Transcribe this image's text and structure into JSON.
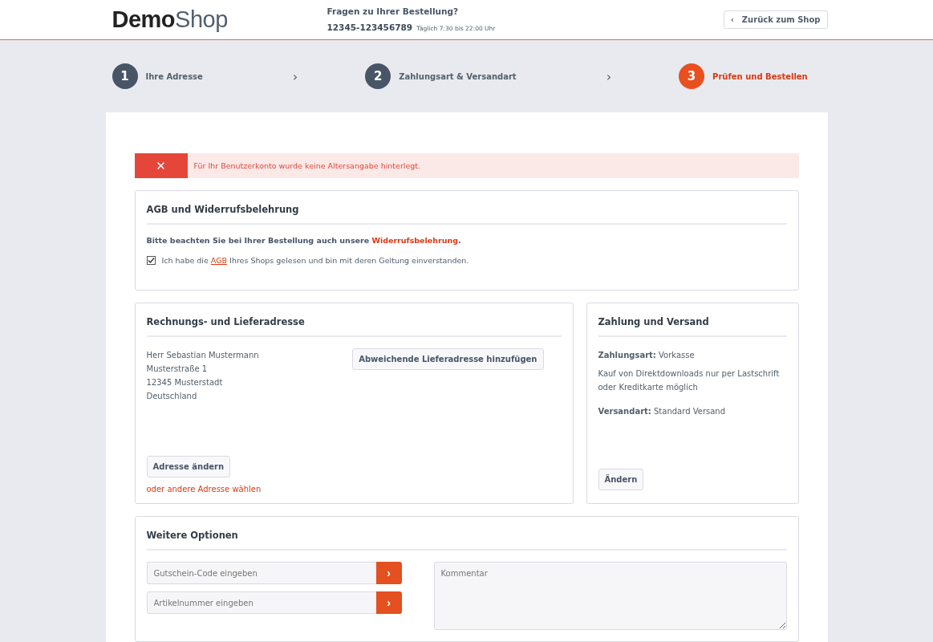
{
  "header": {
    "logo": {
      "bold": "Demo",
      "light": "Shop"
    },
    "question": "Fragen zu Ihrer Bestellung?",
    "phone": "12345-123456789",
    "hours": "Täglich 7:30 bis 22:00 Uhr",
    "back_button": {
      "icon": "‹",
      "label": "Zurück zum Shop"
    }
  },
  "steps": [
    {
      "number": "1",
      "label": "Ihre Adresse",
      "selected": false
    },
    {
      "number": "2",
      "label": "Zahlungsart & Versandart",
      "selected": false
    },
    {
      "number": "3",
      "label": "Prüfen und Bestellen",
      "selected": true
    }
  ],
  "step_separator": "›",
  "error": {
    "icon": "✕",
    "message": "Für Ihr Benutzerkonto wurde keine Altersangabe hinterlegt."
  },
  "agb": {
    "title": "AGB und Widerrufsbelehrung",
    "notice": {
      "before": "Bitte beachten Sie bei Ihrer Bestellung auch unsere ",
      "link": "Widerrufsbelehrung",
      "after": "."
    },
    "checkbox": {
      "checked": true,
      "before": "Ich habe die ",
      "link": "AGB",
      "after": " Ihres Shops gelesen und bin mit deren Geltung einverstanden."
    }
  },
  "address": {
    "title": "Rechnungs- und Lieferadresse",
    "lines": [
      "Herr Sebastian Mustermann",
      "Musterstraße 1",
      "12345 Musterstadt",
      "Deutschland"
    ],
    "add_button": "Abweichende Lieferadresse hinzufügen",
    "change_button": "Adresse ändern",
    "other_link": "oder andere Adresse wählen"
  },
  "payment": {
    "title": "Zahlung und Versand",
    "payment_label": "Zahlungsart:",
    "payment_value": "Vorkasse",
    "note": "Kauf von Direktdownloads nur per Lastschrift oder Kreditkarte möglich",
    "shipping_label": "Versandart:",
    "shipping_value": "Standard Versand",
    "change_button": "Ändern"
  },
  "options": {
    "title": "Weitere Optionen",
    "inputs": [
      {
        "placeholder": "Gutschein-Code eingeben",
        "button": "›"
      },
      {
        "placeholder": "Artikelnummer eingeben",
        "button": "›"
      }
    ],
    "comment": {
      "placeholder": "Kommentar"
    }
  }
}
